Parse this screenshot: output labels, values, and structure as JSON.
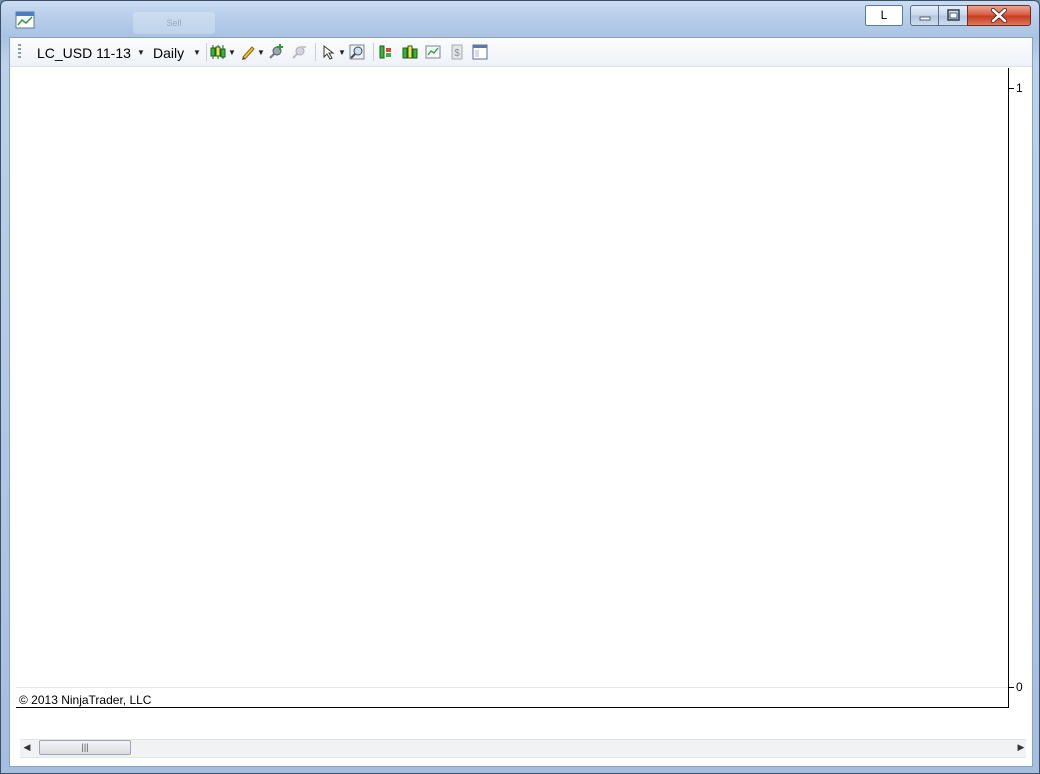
{
  "window": {
    "ghost_tab_label": "Sell",
    "link_button_label": "L",
    "caption": {
      "minimize_icon": "minimize-icon",
      "maximize_icon": "restore-icon",
      "close_icon": "close-icon"
    }
  },
  "toolbar": {
    "instrument": "LC_USD 11-13",
    "interval": "Daily",
    "icons": [
      "candlestick-style-icon",
      "pencil-draw-icon",
      "add-indicator-icon",
      "remove-indicator-icon",
      "cursor-select-icon",
      "zoom-icon",
      "strategy-icon",
      "bar-data-icon",
      "chart-properties-icon",
      "dollar-icon",
      "window-layout-icon"
    ]
  },
  "chart": {
    "y_axis_ticks": [
      "1",
      "0"
    ],
    "copyright": "© 2013 NinjaTrader, LLC"
  },
  "scrollbar": {
    "thumb_grip": "|||"
  },
  "colors": {
    "close_button": "#c7391f",
    "chart_background": "#ffffff",
    "title_bar": "#b6cde9"
  }
}
